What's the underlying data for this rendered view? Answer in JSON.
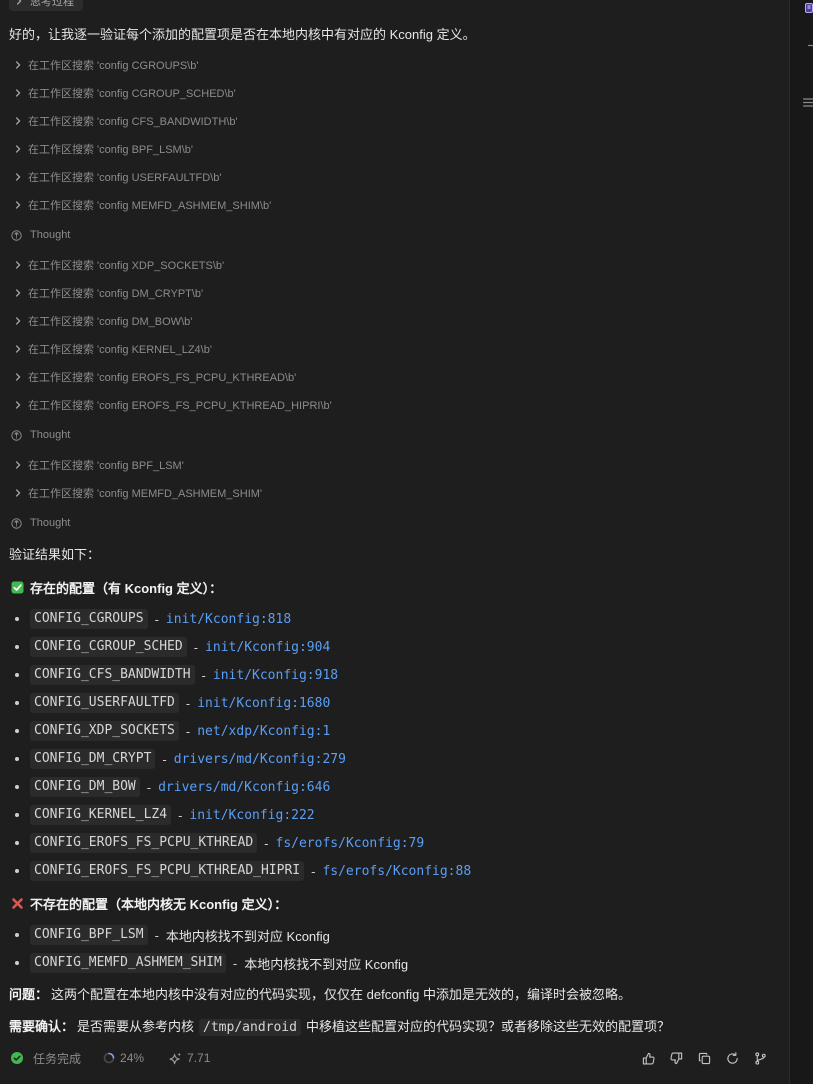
{
  "colors": {
    "background": "#1e1e1e",
    "side_background": "#181818",
    "text": "#e6e6e6",
    "muted": "#8c8c8c",
    "code_bg": "#2b2b2b",
    "code_text": "#d6d6d6",
    "link": "#5a9ef5",
    "success": "#3fb950",
    "error": "#e5534b"
  },
  "thinking_toggle": {
    "icon": "chevron-right-icon",
    "label": "思考过程"
  },
  "message": {
    "intro": "好的，让我逐一验证每个添加的配置项是否在本地内核中有对应的 Kconfig 定义。",
    "steps": [
      {
        "icon": "chevron-right-icon",
        "text": "在工作区搜索 'config CGROUPS\\b'"
      },
      {
        "icon": "chevron-right-icon",
        "text": "在工作区搜索 'config CGROUP_SCHED\\b'"
      },
      {
        "icon": "chevron-right-icon",
        "text": "在工作区搜索 'config CFS_BANDWIDTH\\b'"
      },
      {
        "icon": "chevron-right-icon",
        "text": "在工作区搜索 'config BPF_LSM\\b'"
      },
      {
        "icon": "chevron-right-icon",
        "text": "在工作区搜索 'config USERFAULTFD\\b'"
      },
      {
        "icon": "chevron-right-icon",
        "text": "在工作区搜索 'config MEMFD_ASHMEM_SHIM\\b'"
      },
      {
        "icon": "thought-icon",
        "text": "Thought"
      },
      {
        "icon": "chevron-right-icon",
        "text": "在工作区搜索 'config XDP_SOCKETS\\b'"
      },
      {
        "icon": "chevron-right-icon",
        "text": "在工作区搜索 'config DM_CRYPT\\b'"
      },
      {
        "icon": "chevron-right-icon",
        "text": "在工作区搜索 'config DM_BOW\\b'"
      },
      {
        "icon": "chevron-right-icon",
        "text": "在工作区搜索 'config KERNEL_LZ4\\b'"
      },
      {
        "icon": "chevron-right-icon",
        "text": "在工作区搜索 'config EROFS_FS_PCPU_KTHREAD\\b'"
      },
      {
        "icon": "chevron-right-icon",
        "text": "在工作区搜索 'config EROFS_FS_PCPU_KTHREAD_HIPRI\\b'"
      },
      {
        "icon": "thought-icon",
        "text": "Thought"
      },
      {
        "icon": "chevron-right-icon",
        "text": "在工作区搜索 'config BPF_LSM'"
      },
      {
        "icon": "chevron-right-icon",
        "text": "在工作区搜索 'config MEMFD_ASHMEM_SHIM'"
      },
      {
        "icon": "thought-icon",
        "text": "Thought"
      }
    ],
    "results_intro": "验证结果如下：",
    "found": {
      "icon": "check-mark-button-icon",
      "heading": "存在的配置（有 Kconfig 定义）：",
      "separator": "-",
      "items": [
        {
          "config": "CONFIG_CGROUPS",
          "location": "init/Kconfig:818"
        },
        {
          "config": "CONFIG_CGROUP_SCHED",
          "location": "init/Kconfig:904"
        },
        {
          "config": "CONFIG_CFS_BANDWIDTH",
          "location": "init/Kconfig:918"
        },
        {
          "config": "CONFIG_USERFAULTFD",
          "location": "init/Kconfig:1680"
        },
        {
          "config": "CONFIG_XDP_SOCKETS",
          "location": "net/xdp/Kconfig:1"
        },
        {
          "config": "CONFIG_DM_CRYPT",
          "location": "drivers/md/Kconfig:279"
        },
        {
          "config": "CONFIG_DM_BOW",
          "location": "drivers/md/Kconfig:646"
        },
        {
          "config": "CONFIG_KERNEL_LZ4",
          "location": "init/Kconfig:222"
        },
        {
          "config": "CONFIG_EROFS_FS_PCPU_KTHREAD",
          "location": "fs/erofs/Kconfig:79"
        },
        {
          "config": "CONFIG_EROFS_FS_PCPU_KTHREAD_HIPRI",
          "location": "fs/erofs/Kconfig:88"
        }
      ]
    },
    "missing": {
      "icon": "cross-mark-icon",
      "heading": "不存在的配置（本地内核无 Kconfig 定义）：",
      "separator": "-",
      "items": [
        {
          "config": "CONFIG_BPF_LSM",
          "note": "本地内核找不到对应 Kconfig"
        },
        {
          "config": "CONFIG_MEMFD_ASHMEM_SHIM",
          "note": "本地内核找不到对应 Kconfig"
        }
      ]
    },
    "problem": {
      "label": "问题：",
      "text": "这两个配置在本地内核中没有对应的代码实现，仅仅在 defconfig 中添加是无效的，编译时会被忽略。"
    },
    "confirm": {
      "label": "需要确认：",
      "text_before": "是否需要从参考内核",
      "code": "/tmp/android",
      "text_after": "中移植这些配置对应的代码实现？或者移除这些无效的配置项？"
    }
  },
  "footer": {
    "status_icon": "check-circle-icon",
    "status": "任务完成",
    "progress_icon": "progress-ring-icon",
    "progress": "24%",
    "score_icon": "sparkle-icon",
    "score": "7.71",
    "actions": [
      "thumbs-up-icon",
      "thumbs-down-icon",
      "copy-icon",
      "refresh-icon",
      "branch-icon"
    ]
  },
  "side_panel": {
    "icons": [
      "panel-badge-icon",
      "dash-icon",
      "list-icon"
    ]
  }
}
